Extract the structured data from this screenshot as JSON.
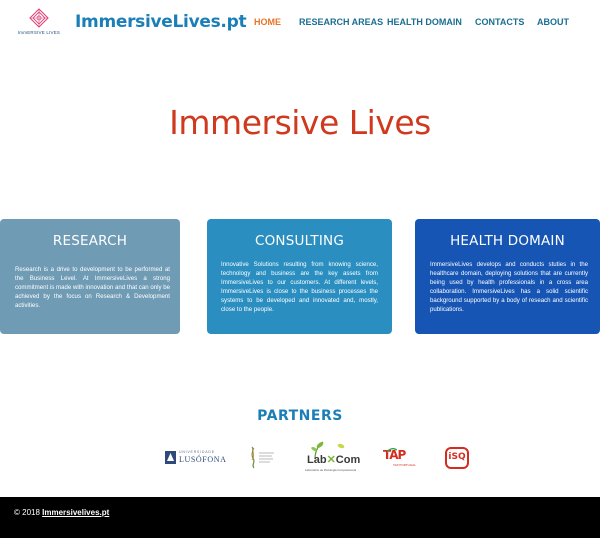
{
  "header": {
    "logo_caption": "ImmERSIVE LIVES",
    "site_title": "ImmersiveLives.pt"
  },
  "nav": {
    "items": [
      {
        "label": "HOME",
        "active": true
      },
      {
        "label": "RESEARCH AREAS",
        "active": false
      },
      {
        "label": "HEALTH DOMAIN",
        "active": false
      },
      {
        "label": "CONTACTS",
        "active": false
      },
      {
        "label": "ABOUT",
        "active": false
      }
    ]
  },
  "hero": {
    "title": "Immersive Lives"
  },
  "cards": {
    "research": {
      "title": "RESEARCH",
      "text": "Research is a drive to development to be performed at the Business Level. At ImmersiveLives a strong commitment is made with innovation and that can only be achieved by the focus on Research & Development activities."
    },
    "consulting": {
      "title": "CONSULTING",
      "text": "Innovative Solutions resulting from knowing science, technology and business are the key assets from ImmersiveLives to our customers. At different levels, ImmersiveLives is close to the business processes the systems to be developed and innovated and, mostly, close to the people."
    },
    "health": {
      "title": "HEALTH DOMAIN",
      "text": "ImmersiveLives develops and conducts stuties in the healthcare domain, deploying solutions that are currently being used by health professionals in a cross area collaboration. ImmersiveLives has a solid scientific background supported by a body of reseach and scientific publications."
    }
  },
  "partners": {
    "title": "PARTNERS",
    "logos": {
      "lusofona": {
        "top_text": "UNIVERSIDADE",
        "name": "LUSÓFONA"
      },
      "lab": {
        "name": "Lab",
        "name2": "Com",
        "caption": "Laboratório de Psicologia Computacional"
      },
      "tap": {
        "name": "TAP",
        "caption": "TAP PORTUGAL"
      },
      "isq": {
        "name": "iSQ"
      }
    }
  },
  "footer": {
    "copyright": "© 2018",
    "link": "Immersivelives.pt"
  },
  "colors": {
    "accent": "#1a7fb7",
    "nav_active": "#e8742a",
    "hero_title": "#cf3a1e",
    "research_card": "#6f9bb5",
    "consulting_card": "#2a8ec0",
    "health_card": "#1655b4",
    "footer_bg": "#000000"
  }
}
